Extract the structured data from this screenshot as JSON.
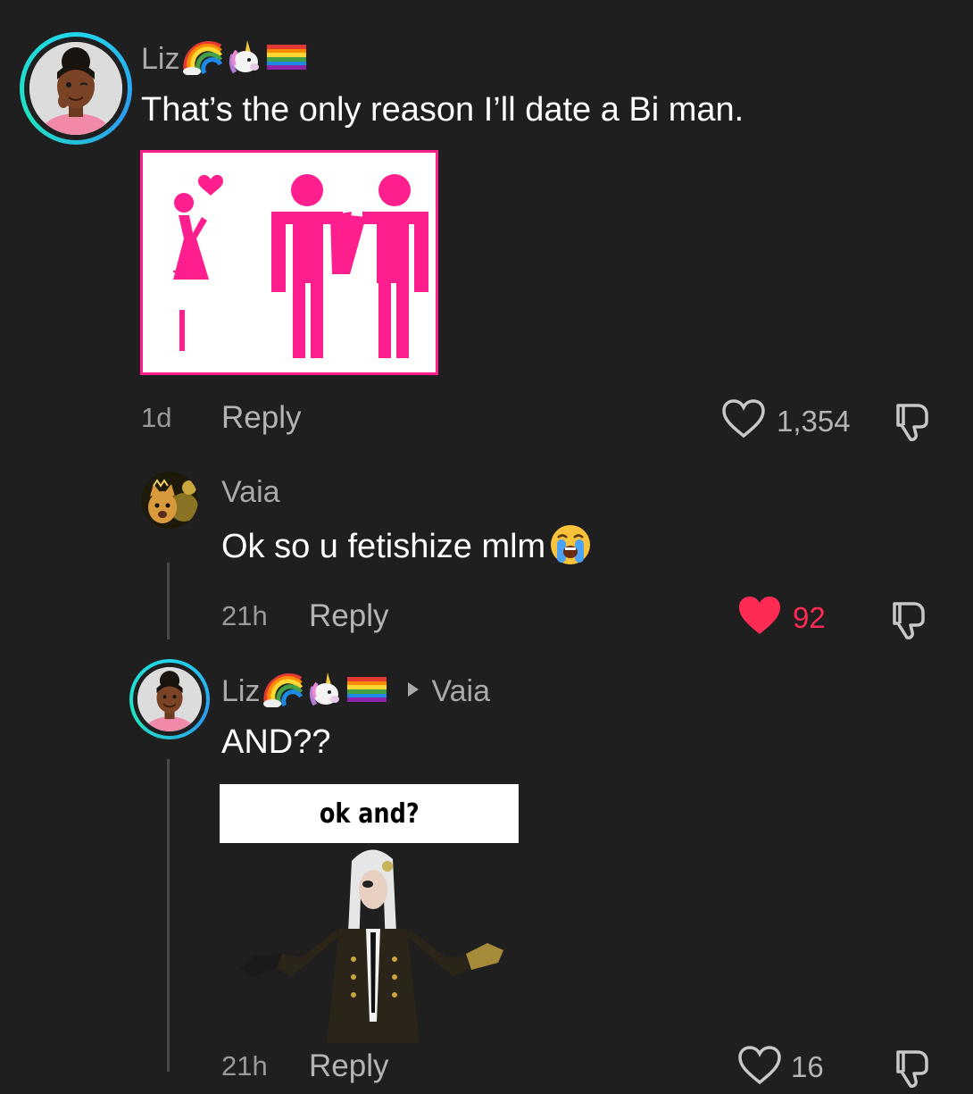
{
  "comments": [
    {
      "username": "Liz",
      "badges": [
        "rainbow-icon",
        "unicorn-icon",
        "rainbow-flag-icon"
      ],
      "text": "That’s the only reason I’ll date a Bi man.",
      "time": "1d",
      "reply_label": "Reply",
      "likes": "1,354",
      "liked": false
    },
    {
      "username": "Vaia",
      "text": "Ok so u fetishize mlm",
      "text_emoji": "loudly-crying-face-icon",
      "time": "21h",
      "reply_label": "Reply",
      "likes": "92",
      "liked": true
    },
    {
      "username": "Liz",
      "badges": [
        "rainbow-icon",
        "unicorn-icon",
        "rainbow-flag-icon"
      ],
      "reply_to": "Vaia",
      "text": "AND??",
      "sticker_caption": "ok and?",
      "time": "21h",
      "reply_label": "Reply",
      "likes": "16",
      "liked": false
    }
  ],
  "colors": {
    "background": "#1f1f1f",
    "like_active": "#fe2c55",
    "avatar_ring": "#20d5ec",
    "sticker_pink": "#ff1e8e"
  }
}
